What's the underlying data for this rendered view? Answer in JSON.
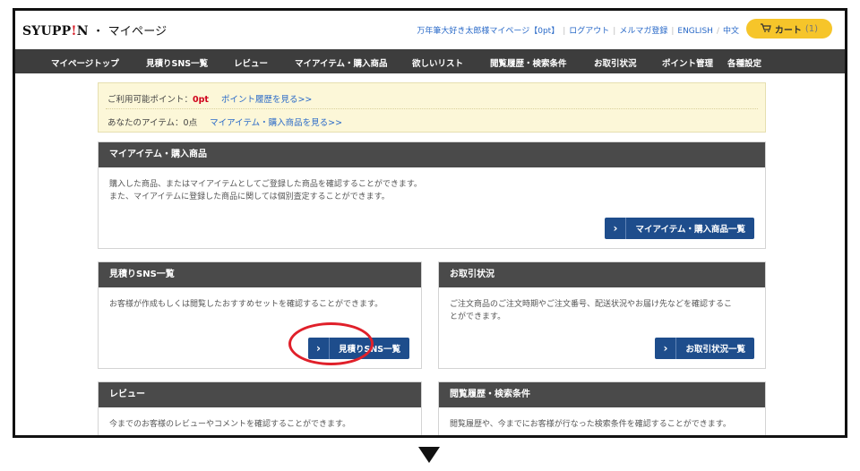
{
  "header": {
    "logo_brand": "SYUPP",
    "logo_bang": "!",
    "logo_brand_end": "N",
    "logo_sep": " ・ ",
    "logo_page": "マイページ",
    "user_link": "万年筆大好き太郎様マイページ【0pt】",
    "links": [
      "ログアウト",
      "メルマガ登録",
      "ENGLISH",
      "中文"
    ],
    "cart_label": "カート",
    "cart_count": "(1)"
  },
  "nav": {
    "items": [
      "マイページトップ",
      "見積りSNS一覧",
      "レビュー",
      "マイアイテム・購入商品",
      "欲しいリスト",
      "閲覧履歴・検索条件",
      "お取引状況",
      "ポイント管理",
      "各種設定"
    ]
  },
  "notice": {
    "points_label": "ご利用可能ポイント：",
    "points_value": "0pt",
    "points_link": "ポイント履歴を見る>>",
    "items_label": "あなたのアイテム：0点",
    "items_link": "マイアイテム・購入商品を見る>>"
  },
  "panels": {
    "myitems": {
      "title": "マイアイテム・購入商品",
      "line1": "購入した商品、またはマイアイテムとしてご登録した商品を確認することができます。",
      "line2": "また、マイアイテムに登録した商品に関しては個別査定することができます。",
      "button": "マイアイテム・購入商品一覧"
    },
    "sns": {
      "title": "見積りSNS一覧",
      "line1": "お客様が作成もしくは閲覧したおすすめセットを確認することができます。",
      "button": "見積りSNS一覧"
    },
    "deals": {
      "title": "お取引状況",
      "line1": "ご注文商品のご注文時期やご注文番号、配送状況やお届け先などを確認するこ",
      "line2": "とができます。",
      "button": "お取引状況一覧"
    },
    "review": {
      "title": "レビュー",
      "line1": "今までのお客様のレビューやコメントを確認することができます。"
    },
    "history": {
      "title": "閲覧履歴・検索条件",
      "line1": "閲覧履歴や、今までにお客様が行なった検索条件を確認することができます。"
    }
  },
  "colors": {
    "nav_bg": "#3d3d3d",
    "panel_header": "#4a4a4a",
    "button": "#1e4d8c",
    "cart": "#f6c52a",
    "highlight": "#e0202a",
    "link": "#2a6ac8"
  }
}
